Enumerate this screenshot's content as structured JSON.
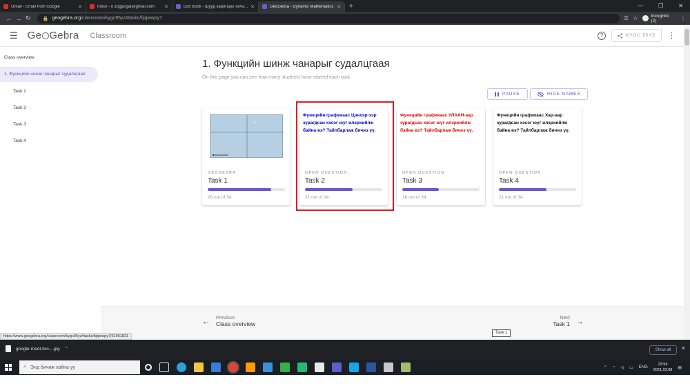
{
  "browser": {
    "tabs": [
      {
        "label": "Gmail - Email from Google",
        "favicon_color": "#d93025",
        "active": false
      },
      {
        "label": "Inbox - n.zogjargal@gmail.com",
        "favicon_color": "#d93025",
        "active": false
      },
      {
        "label": "Edit Book - Шууд харилцах хичээл",
        "favicon_color": "#6b5ecf",
        "active": false
      },
      {
        "label": "GeoGebra - Dynamic Mathematics",
        "favicon_color": "#6b5ecf",
        "active": true
      }
    ],
    "url_host": "geogebra.org",
    "url_path": "/classroom/kygc95yz#tasks/bjqwwpy7",
    "incognito_label": "Incognito (2)"
  },
  "header": {
    "logo": "GeoGebra",
    "section": "Classroom",
    "class_code": "KYGC 95YZ"
  },
  "sidebar": {
    "overview": "Class overview",
    "activity": "1. Функцийн шинж чанарыг судалцгаая",
    "tasks": [
      "Task 1",
      "Task 2",
      "Task 3",
      "Task 4"
    ]
  },
  "main": {
    "title": "1. Функцийн шинж чанарыг судалцгаая",
    "subtitle": "On this page you can see how many students have started each task",
    "pause_label": "PAUSE",
    "hide_names_label": "HIDE NAMES"
  },
  "cards": [
    {
      "type": "GEOGEBRA",
      "name": "Task 1",
      "question": "",
      "question_color": "",
      "progress": 0.82,
      "count": "28 out of 34"
    },
    {
      "type": "OPEN QUESTION",
      "name": "Task 2",
      "question": "Функцийн графикаас Цэнхэр-ээр зурагдсан хэсэг юуг илэрхийлж байна вэ? Тайлбарлаж бичнэ үү.",
      "question_color": "#0000cc",
      "progress": 0.62,
      "count": "21 out of 34"
    },
    {
      "type": "OPEN QUESTION",
      "name": "Task 3",
      "question": "Функцийн графикаас УЛААН-аар зурагдсан хэсэг юуг илэрхийлж байна вэ? Тайлбарлаж бичнэ үү.",
      "question_color": "#e00000",
      "progress": 0.47,
      "count": "16 out of 34"
    },
    {
      "type": "OPEN QUESTION",
      "name": "Task 4",
      "question": "Функцийн графикаас Хар-аар зурагдсан хэсэг юуг илэрхийлж байна вэ? Тайлбарлаж бичнэ үү.",
      "question_color": "#111111",
      "progress": 0.62,
      "count": "21 out of 34"
    }
  ],
  "footer": {
    "prev_small": "Previous",
    "prev_big": "Class overview",
    "next_small": "Next",
    "next_big": "Task 1",
    "tooltip": "Task 1",
    "status_url": "https://www.geogebra.org/classroom/kygc95yz#tasks/bjqwwpy7/31061821"
  },
  "downloads": {
    "file": "google-meet-bro....jpg",
    "show_all": "Show all"
  },
  "taskbar": {
    "search_placeholder": "Энд бичиж хайна уу",
    "lang": "ENG",
    "time": "23:54",
    "date": "2021.03.08"
  },
  "colors": {
    "accent": "#6557d2",
    "highlight": "#e0191f"
  }
}
